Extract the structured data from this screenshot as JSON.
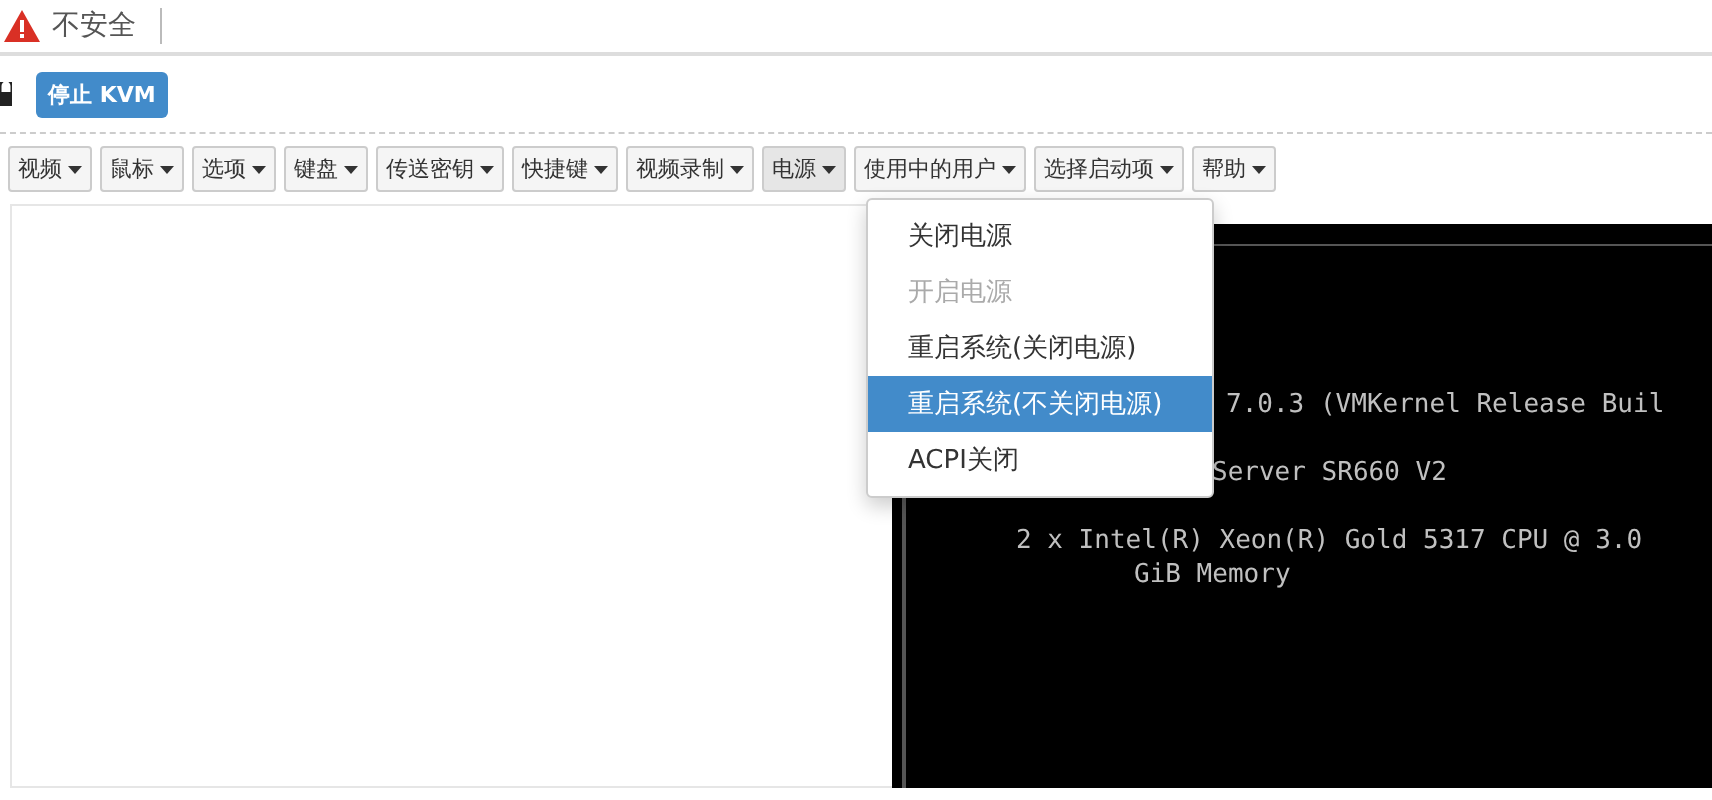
{
  "address_bar": {
    "security_label": "不安全"
  },
  "kvm_button": {
    "label": "停止 KVM"
  },
  "toolbar": [
    {
      "label": "视频",
      "expanded": false
    },
    {
      "label": "鼠标",
      "expanded": false
    },
    {
      "label": "选项",
      "expanded": false
    },
    {
      "label": "键盘",
      "expanded": false
    },
    {
      "label": "传送密钥",
      "expanded": false
    },
    {
      "label": "快捷键",
      "expanded": false
    },
    {
      "label": "视频录制",
      "expanded": false
    },
    {
      "label": "电源",
      "expanded": true
    },
    {
      "label": "使用中的用户",
      "expanded": false
    },
    {
      "label": "选择启动项",
      "expanded": false
    },
    {
      "label": "帮助",
      "expanded": false
    }
  ],
  "power_menu": [
    {
      "label": "关闭电源",
      "disabled": false,
      "selected": false
    },
    {
      "label": "开启电源",
      "disabled": true,
      "selected": false
    },
    {
      "label": "重启系统(关闭电源)",
      "disabled": false,
      "selected": false
    },
    {
      "label": "重启系统(不关闭电源)",
      "disabled": false,
      "selected": true
    },
    {
      "label": "ACPI关闭",
      "disabled": false,
      "selected": false
    }
  ],
  "console_lines": [
    "7.0.3 (VMKernel Release Buil",
    "Server SR660 V2",
    "2 x Intel(R) Xeon(R) Gold 5317 CPU @ 3.0",
    "GiB Memory"
  ]
}
